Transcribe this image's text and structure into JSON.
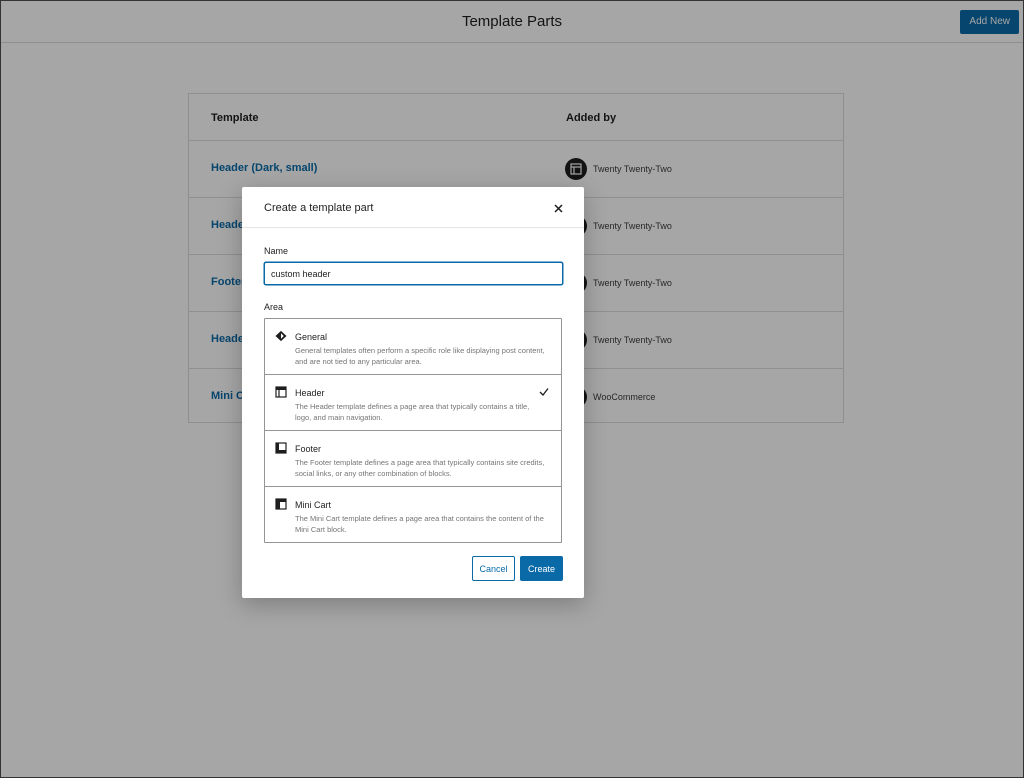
{
  "header": {
    "title": "Template Parts",
    "add_new_label": "Add New"
  },
  "table": {
    "columns": [
      "Template",
      "Added by"
    ],
    "rows": [
      {
        "name": "Header (Dark, small)",
        "added_by": "Twenty Twenty-Two"
      },
      {
        "name": "Header",
        "added_by": "Twenty Twenty-Two"
      },
      {
        "name": "Footer",
        "added_by": "Twenty Twenty-Two"
      },
      {
        "name": "Header",
        "added_by": "Twenty Twenty-Two"
      },
      {
        "name": "Mini C",
        "added_by": "WooCommerce"
      }
    ]
  },
  "modal": {
    "title": "Create a template part",
    "name_label": "Name",
    "name_value": "custom header",
    "area_label": "Area",
    "areas": [
      {
        "title": "General",
        "description": "General templates often perform a specific role like displaying post content, and are not tied to any particular area.",
        "icon": "diamond-icon",
        "selected": false
      },
      {
        "title": "Header",
        "description": "The Header template defines a page area that typically contains a title, logo, and main navigation.",
        "icon": "header-layout-icon",
        "selected": true
      },
      {
        "title": "Footer",
        "description": "The Footer template defines a page area that typically contains site credits, social links, or any other combination of blocks.",
        "icon": "footer-layout-icon",
        "selected": false
      },
      {
        "title": "Mini Cart",
        "description": "The Mini Cart template defines a page area that contains the content of the Mini Cart block.",
        "icon": "sidebar-layout-icon",
        "selected": false
      }
    ],
    "cancel_label": "Cancel",
    "create_label": "Create"
  },
  "colors": {
    "accent": "#0a6aa8",
    "overlay": "rgba(0,0,0,0.35)"
  }
}
